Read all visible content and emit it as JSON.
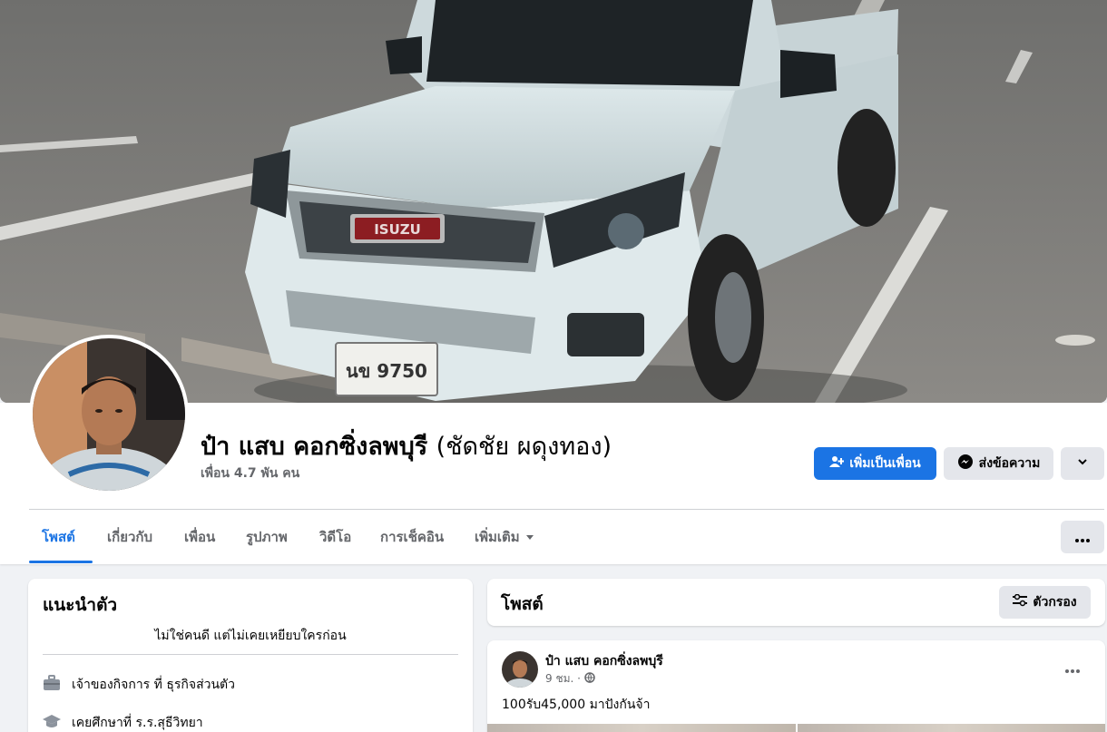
{
  "cover": {
    "plate_text": "นข 9750",
    "brand_text": "ISUZU"
  },
  "profile": {
    "name": "ป๋า แสบ คอกซิ่งลพบุรี",
    "alt_name": "(ชัดชัย ผดุงทอง)",
    "friends": "เพื่อน 4.7 พัน คน"
  },
  "actions": {
    "add_friend": "เพิ่มเป็นเพื่อน",
    "message": "ส่งข้อความ"
  },
  "tabs": [
    {
      "label": "โพสต์",
      "active": true
    },
    {
      "label": "เกี่ยวกับ",
      "active": false
    },
    {
      "label": "เพื่อน",
      "active": false
    },
    {
      "label": "รูปภาพ",
      "active": false
    },
    {
      "label": "วิดีโอ",
      "active": false
    },
    {
      "label": "การเช็คอิน",
      "active": false
    },
    {
      "label": "เพิ่มเติม",
      "active": false
    }
  ],
  "intro": {
    "title": "แนะนำตัว",
    "bio": "ไม่ใช่คนดี แต่ไม่เคยเหยียบใครก่อน",
    "items": [
      {
        "icon": "briefcase-icon",
        "text": "เจ้าของกิจการ ที่ ธุรกิจส่วนตัว"
      },
      {
        "icon": "graduation-cap-icon",
        "text": "เคยศึกษาที่ ร.ร.สุธีวิทยา"
      }
    ]
  },
  "posts": {
    "title": "โพสต์",
    "filter_label": "ตัวกรอง",
    "items": [
      {
        "author": "ป๋า แสบ คอกซิ่งลพบุรี",
        "time": "9 ชม. ·",
        "privacy_icon": "globe-icon",
        "text": "100รับ45,000 มาปังกันจ้า"
      }
    ]
  },
  "colors": {
    "accent": "#1b74e4",
    "secondary_button": "#e4e6eb",
    "page_bg": "#f0f2f5"
  }
}
